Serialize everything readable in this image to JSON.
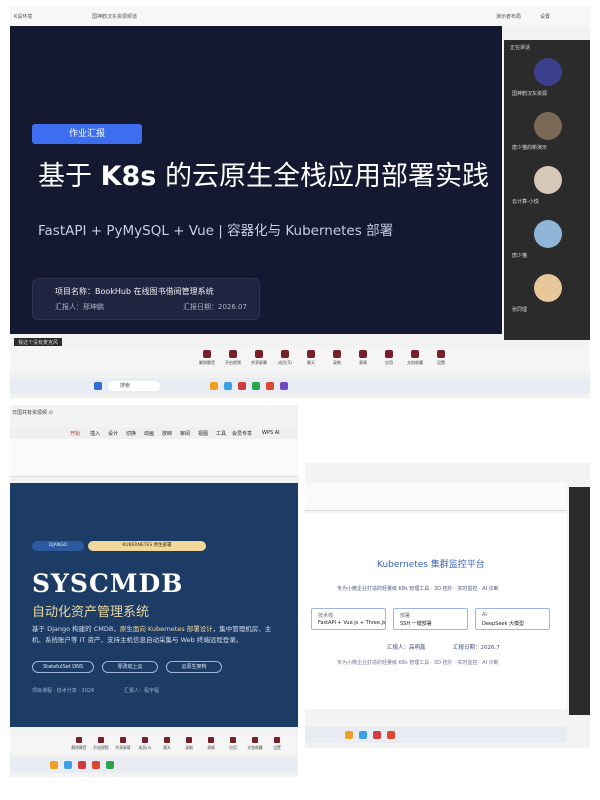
{
  "meeting": {
    "topbar": {
      "left_text": "K设环境",
      "meeting_name": "国神鹤汉东资源频道",
      "right_view": "演示者布局",
      "right_settings": "设置"
    },
    "slide": {
      "tag": "作业汇报",
      "title_prefix": "基于 ",
      "title_bold": "K8s",
      "title_suffix": " 的云原生全栈应用部署实践",
      "subtitle": "FastAPI + PyMySQL + Vue | 容器化与 Kubernetes 部署",
      "project_label": "项目名称：BookHub 在线图书借阅管理系统",
      "reporter": "汇报人：邢坤鹏",
      "report_date": "汇报日期：2026.07"
    },
    "notice": "我这个没有麦克风",
    "participants_header": "正在讲话",
    "participants": [
      {
        "name": "国神鹤汉东资源",
        "color": "#3b3f8c"
      },
      {
        "name": "唐少猫的新演示",
        "color": "#7a6a55"
      },
      {
        "name": "云计算-小悦",
        "color": "#d9c9b8"
      },
      {
        "name": "唐少猫",
        "color": "#8fb6d9"
      },
      {
        "name": "张同理",
        "color": "#e8c79a"
      }
    ],
    "controls": [
      "解除静音",
      "开启视频",
      "共享屏幕",
      "成员(5)",
      "聊天",
      "录制",
      "表情",
      "应用",
      "文档收藏",
      "设置"
    ],
    "taskbar_search": "搜索"
  },
  "wps1": {
    "title": "日国共有资源频 ⊙",
    "tabs": [
      "开始",
      "插入",
      "设计",
      "切换",
      "动画",
      "放映",
      "审阅",
      "视图",
      "工具",
      "会员专享",
      "WPS AI"
    ],
    "slide": {
      "pill_a": "DJANGO",
      "pill_b": "KUBERNETES 原生部署",
      "title": "SYSCMDB",
      "subtitle": "自动化资产管理系统",
      "desc_a": "基于 Django 构建的 CMDB，",
      "desc_hl": "原生面向 Kubernetes 部署设计",
      "desc_b": "，集中管理机房、主机、系统账户等 IT 资产，支持主机信息自动采集与 Web 终端远程登录。",
      "buttons": [
        "StatefulSet DNS",
        "零改动上云",
        "云原生架构"
      ],
      "footer_a": "项目课程 · 技术分享 · 2026",
      "footer_b": "汇报人：程宇程"
    },
    "controls": [
      "解除静音",
      "开启视频",
      "共享屏幕",
      "成员(5)",
      "聊天",
      "录制",
      "表情",
      "应用",
      "文档收藏",
      "设置"
    ]
  },
  "wps2": {
    "slide": {
      "title": "Kubernetes 集群监控平台",
      "subtitle": "专为小微企业打造的轻量级 K8s 管理工具 · 3D 拓扑 · 实时监控 · AI 诊断",
      "boxes": [
        {
          "head": "技术栈",
          "value": "FastAPI + Vue.js + Three.js"
        },
        {
          "head": "部署",
          "value": "SSH 一键部署"
        },
        {
          "head": "AI",
          "value": "DeepSeek 大模型"
        }
      ],
      "reporter": "汇报人：高明鑫",
      "report_date": "汇报日期：2026.7",
      "footer": "专为小微企业打造的轻量级 K8s 管理工具 · 3D 拓扑 · 实时监控 · AI 诊断"
    }
  }
}
